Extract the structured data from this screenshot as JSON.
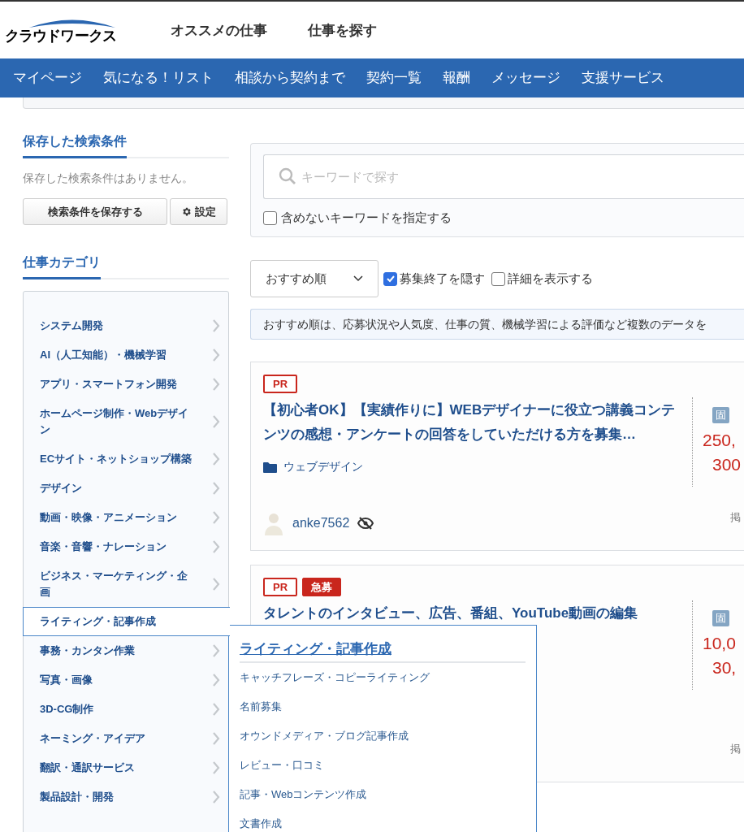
{
  "header": {
    "logo": "クラウドワークス",
    "links": [
      "オススメの仕事",
      "仕事を探す"
    ]
  },
  "nav": [
    "マイページ",
    "気になる！リスト",
    "相談から契約まで",
    "契約一覧",
    "報酬",
    "メッセージ",
    "支援サービス"
  ],
  "saved_search": {
    "title": "保存した検索条件",
    "empty_text": "保存した検索条件はありません。",
    "save_button": "検索条件を保存する",
    "settings_button": "設定"
  },
  "categories": {
    "title": "仕事カテゴリ",
    "items": [
      {
        "label": "システム開発",
        "selected": false
      },
      {
        "label": "AI（人工知能）・機械学習",
        "selected": false
      },
      {
        "label": "アプリ・スマートフォン開発",
        "selected": false
      },
      {
        "label": "ホームページ制作・Webデザイン",
        "selected": false
      },
      {
        "label": "ECサイト・ネットショップ構築",
        "selected": false
      },
      {
        "label": "デザイン",
        "selected": false
      },
      {
        "label": "動画・映像・アニメーション",
        "selected": false
      },
      {
        "label": "音楽・音響・ナレーション",
        "selected": false
      },
      {
        "label": "ビジネス・マーケティング・企画",
        "selected": false
      },
      {
        "label": "ライティング・記事作成",
        "selected": true
      },
      {
        "label": "事務・カンタン作業",
        "selected": false
      },
      {
        "label": "写真・画像",
        "selected": false
      },
      {
        "label": "3D-CG制作",
        "selected": false
      },
      {
        "label": "ネーミング・アイデア",
        "selected": false
      },
      {
        "label": "翻訳・通訳サービス",
        "selected": false
      },
      {
        "label": "製品設計・開発",
        "selected": false
      }
    ]
  },
  "submenu": {
    "title": "ライティング・記事作成",
    "items": [
      "キャッチフレーズ・コピーライティング",
      "名前募集",
      "オウンドメディア・ブログ記事作成",
      "レビュー・口コミ",
      "記事・Webコンテンツ作成",
      "文書作成"
    ]
  },
  "search": {
    "placeholder": "キーワードで探す",
    "exclude_label": "含めないキーワードを指定する",
    "exclude_checked": false
  },
  "sort": {
    "value": "おすすめ順",
    "options": [
      {
        "label": "募集終了を隠す",
        "checked": true
      },
      {
        "label": "詳細を表示する",
        "checked": false
      }
    ]
  },
  "notice": "おすすめ順は、応募状況や人気度、仕事の質、機械学習による評価など複数のデータを",
  "jobs": [
    {
      "badges": [
        {
          "label": "PR",
          "kind": "outline"
        }
      ],
      "title": "【初心者OK】【実績作りに】WEBデザイナーに役立つ講義コンテンツの感想・アンケートの回答をしていただける方を募集…",
      "category": "ウェブデザイン",
      "price_type": "固",
      "prices": [
        "250,",
        "300"
      ],
      "client": "anke7562",
      "client_hidden": true,
      "date_label": "掲"
    },
    {
      "badges": [
        {
          "label": "PR",
          "kind": "outline"
        },
        {
          "label": "急募",
          "kind": "filled"
        }
      ],
      "title": "タレントのインタビュー、広告、番組、YouTube動画の編集",
      "price_type": "固",
      "prices": [
        "10,0",
        "30,"
      ],
      "date_label": "掲"
    }
  ]
}
